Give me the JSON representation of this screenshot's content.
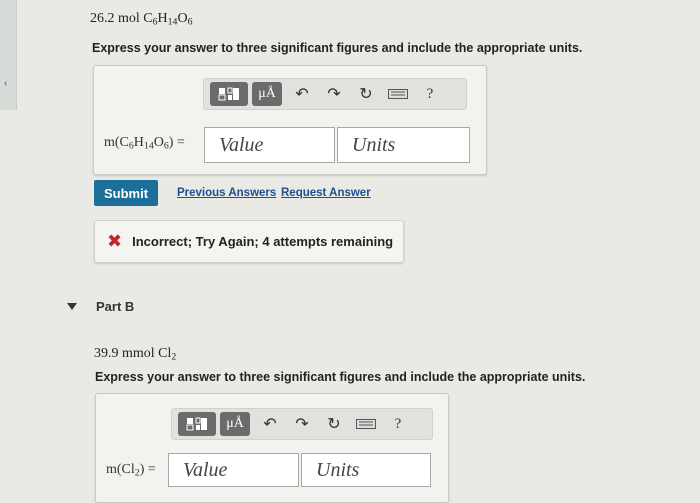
{
  "part_a": {
    "question_prefix": "26.2 mol",
    "question_formula_html": "C<sub>6</sub>H<sub>14</sub>O<sub>6</sub>",
    "instructions": "Express your answer to three significant figures and include the appropriate units.",
    "label_html": "m(C<sub>6</sub>H<sub>14</sub>O<sub>6</sub>) =",
    "value_placeholder": "Value",
    "units_placeholder": "Units",
    "submit_label": "Submit",
    "previous_answers_label": "Previous Answers",
    "request_answer_label": "Request Answer",
    "feedback": "Incorrect; Try Again; 4 attempts remaining"
  },
  "part_b": {
    "heading": "Part B",
    "question_prefix": "39.9 mmol",
    "question_formula_html": "Cl<sub>2</sub>",
    "instructions": "Express your answer to three significant figures and include the appropriate units.",
    "label_html": "m(Cl<sub>2</sub>) =",
    "value_placeholder": "Value",
    "units_placeholder": "Units"
  },
  "toolbar": {
    "templates_icon": "templates-icon",
    "units_button_label": "μÅ",
    "undo_icon": "undo-icon",
    "redo_icon": "redo-icon",
    "reset_icon": "reset-icon",
    "keyboard_icon": "keyboard-icon",
    "help_label": "?"
  },
  "colors": {
    "submit_bg": "#1b6f99",
    "link": "#1f4f8f",
    "error": "#c0282c",
    "toolbar_button": "#6b6b6b"
  }
}
